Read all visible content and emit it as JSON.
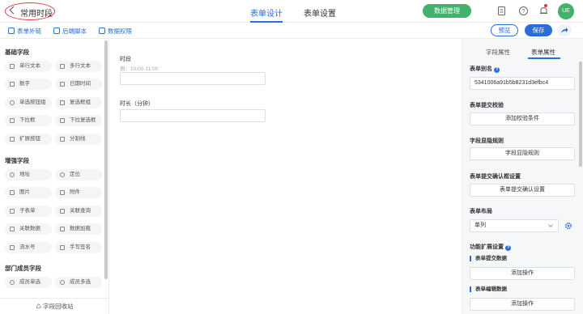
{
  "header": {
    "back_title": "常用时段",
    "tabs": [
      "表单设计",
      "表单设置"
    ],
    "data_button": "数据管理",
    "avatar_text": "UE"
  },
  "toolbar": {
    "external_link": "表单外链",
    "backend_script": "后端脚本",
    "data_permission": "数据权限",
    "preview": "预览",
    "save": "保存"
  },
  "left_panel": {
    "groups": [
      {
        "title": "基础字段",
        "items": [
          "单行文本",
          "多行文本",
          "数字",
          "日期时间",
          "单选按钮组",
          "复选框组",
          "下拉框",
          "下拉复选框",
          "扩展按钮",
          "分割线"
        ]
      },
      {
        "title": "增强字段",
        "items": [
          "地址",
          "定位",
          "图片",
          "附件",
          "子表单",
          "关联查询",
          "关联数据",
          "数据加载",
          "流水号",
          "手写签名"
        ]
      },
      {
        "title": "部门成员字段",
        "items": [
          "成员单选",
          "成员多选"
        ]
      }
    ],
    "recycle": "字段回收站"
  },
  "canvas": {
    "fields": [
      {
        "label": "时段",
        "hint": "例：10:00-11:00"
      },
      {
        "label": "时长（分钟）",
        "hint": ""
      }
    ]
  },
  "right_panel": {
    "tabs": [
      "字段属性",
      "表单属性"
    ],
    "alias_label": "表单别名",
    "alias_value": "5341006a91b5b8231d3efbc4",
    "validation_label": "表单提交校验",
    "validation_button": "添加校验条件",
    "visibility_label": "字段显隐规则",
    "visibility_button": "字段显隐规则",
    "confirm_label": "表单提交确认框设置",
    "confirm_button": "表单提交确认设置",
    "layout_label": "表单布局",
    "layout_value": "单列",
    "ext_label": "功能扩展设置",
    "submit_data_label": "表单提交数据",
    "submit_data_button": "添加操作",
    "edit_data_label": "表单编辑数据",
    "edit_data_button": "添加操作"
  },
  "colors": {
    "accent": "#2a6cd8",
    "green": "#3fb36b",
    "highlight_ring": "#e0373c"
  }
}
